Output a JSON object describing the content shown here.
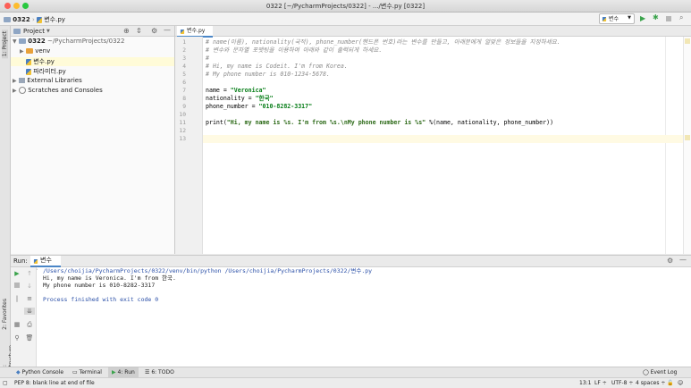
{
  "window": {
    "title": "0322 [~/PycharmProjects/0322] - .../변수.py [0322]"
  },
  "nav": {
    "project": "0322",
    "file": "변수.py",
    "run_config": "변수"
  },
  "sidebar": {
    "left_tabs": {
      "project": "1: Project",
      "favorites": "2: Favorites",
      "structure": "7: Structure"
    },
    "header": "Project",
    "tree": [
      {
        "label": "0322",
        "detail": "~/PycharmProjects/0322"
      },
      {
        "label": "venv"
      },
      {
        "label": "변수.py"
      },
      {
        "label": "파라미터.py"
      },
      {
        "label": "External Libraries"
      },
      {
        "label": "Scratches and Consoles"
      }
    ]
  },
  "editor": {
    "tab": "변수.py",
    "lines": [
      {
        "n": "1",
        "text": "# name(이름), nationality(국적), phone_number(핸드폰 번호)라는 변수를 만들고, 아래분에게 알맞은 정보들을 지정하세요."
      },
      {
        "n": "2",
        "text": "# 변수와 문자열 포맷팅을 이용하여 아래와 같이 출력되게 하세요."
      },
      {
        "n": "3",
        "text": "#"
      },
      {
        "n": "4",
        "text": "# Hi, my name is Codeit. I'm from Korea."
      },
      {
        "n": "5",
        "text": "# My phone number is 010-1234-5678."
      },
      {
        "n": "6",
        "text": ""
      },
      {
        "n": "7",
        "a": "name = ",
        "b": "\"Veronica\""
      },
      {
        "n": "8",
        "a": "nationality = ",
        "b": "\"한국\""
      },
      {
        "n": "9",
        "a": "phone_number = ",
        "b": "\"010-8282-3317\""
      },
      {
        "n": "10",
        "text": ""
      },
      {
        "n": "11",
        "a": "print(",
        "b": "\"Hi, my name is %s. I'm from %s.\\nMy phone number is %s\"",
        "c": " %(name, nationality, phone_number))"
      },
      {
        "n": "12",
        "text": ""
      },
      {
        "n": "13",
        "text": ""
      }
    ]
  },
  "run": {
    "label": "Run:",
    "tab": "변수",
    "output": [
      "/Users/choijia/PycharmProjects/0322/venv/bin/python /Users/choijia/PycharmProjects/0322/변수.py",
      "Hi, my name is Veronica. I'm from 한국.",
      "My phone number is 010-8282-3317",
      "",
      "Process finished with exit code 0"
    ]
  },
  "bottom_tabs": {
    "python_console": "Python Console",
    "terminal": "Terminal",
    "run": "4: Run",
    "todo": "6: TODO",
    "event_log": "Event Log"
  },
  "status": {
    "message": "PEP 8: blank line at end of file",
    "position": "13:1",
    "line_sep": "LF ÷",
    "encoding": "UTF-8 ÷",
    "indent": "4 spaces ÷"
  },
  "colors": {
    "accent": "#4a86c7",
    "selection": "#fffbd8",
    "string": "#067d17",
    "comment": "#8c8c8c"
  }
}
